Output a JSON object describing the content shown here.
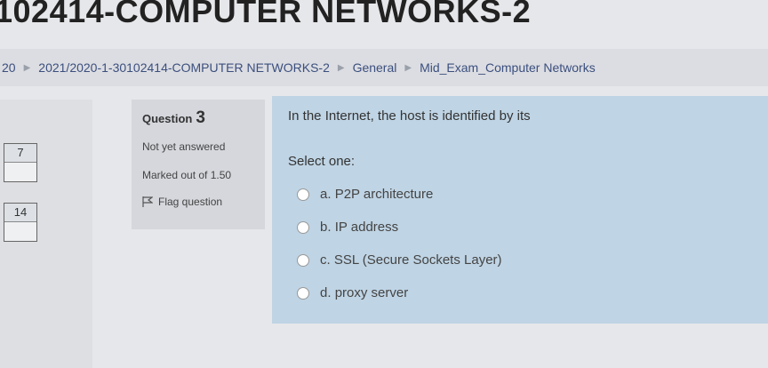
{
  "page_title": "102414-COMPUTER NETWORKS-2",
  "breadcrumb": [
    "20",
    "2021/2020-1-30102414-COMPUTER NETWORKS-2",
    "General",
    "Mid_Exam_Computer Networks"
  ],
  "quiz_nav": [
    {
      "label": "7"
    },
    {
      "label": "14"
    }
  ],
  "question_info": {
    "label": "Question",
    "number": "3",
    "state": "Not yet answered",
    "grade": "Marked out of 1.50",
    "flag": "Flag question"
  },
  "question": {
    "text": "In the Internet, the host is identified by its",
    "prompt": "Select one:",
    "options": [
      {
        "letter": "a.",
        "text": "P2P architecture"
      },
      {
        "letter": "b.",
        "text": "IP address"
      },
      {
        "letter": "c.",
        "text": "SSL (Secure Sockets Layer)"
      },
      {
        "letter": "d.",
        "text": "proxy server"
      }
    ]
  },
  "icons": {
    "breadcrumb_separator": "play-triangle-icon",
    "flag": "flag-icon",
    "radio": "radio-button"
  }
}
